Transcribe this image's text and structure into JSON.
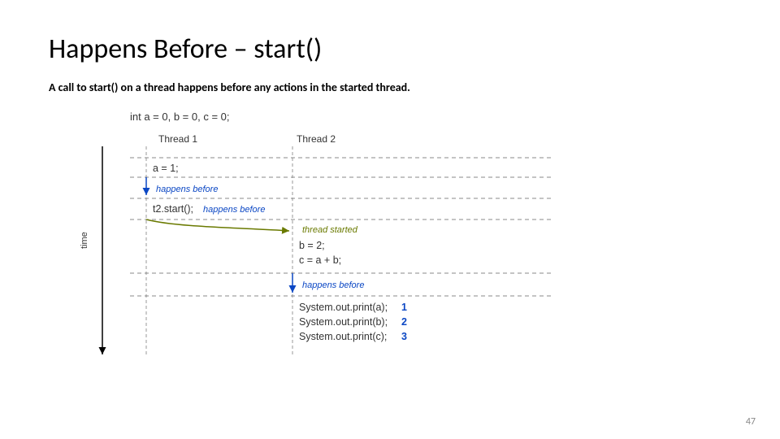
{
  "slide": {
    "title": "Happens Before – start()",
    "subtitle": "A call to start() on a thread happens before any actions in the started thread.",
    "page_number": "47"
  },
  "diagram": {
    "init": "int a = 0, b = 0, c = 0;",
    "thread1_label": "Thread 1",
    "thread2_label": "Thread 2",
    "time_label": "time",
    "t1_action1": "a = 1;",
    "hb1": "happens before",
    "t1_action2": "t2.start();",
    "hb2": "happens before",
    "thread_started": "thread started",
    "t2_action1": "b = 2;",
    "t2_action2": "c = a + b;",
    "hb3": "happens before",
    "t2_print1": "System.out.print(a);",
    "t2_print2": "System.out.print(b);",
    "t2_print3": "System.out.print(c);",
    "out1": "1",
    "out2": "2",
    "out3": "3"
  }
}
